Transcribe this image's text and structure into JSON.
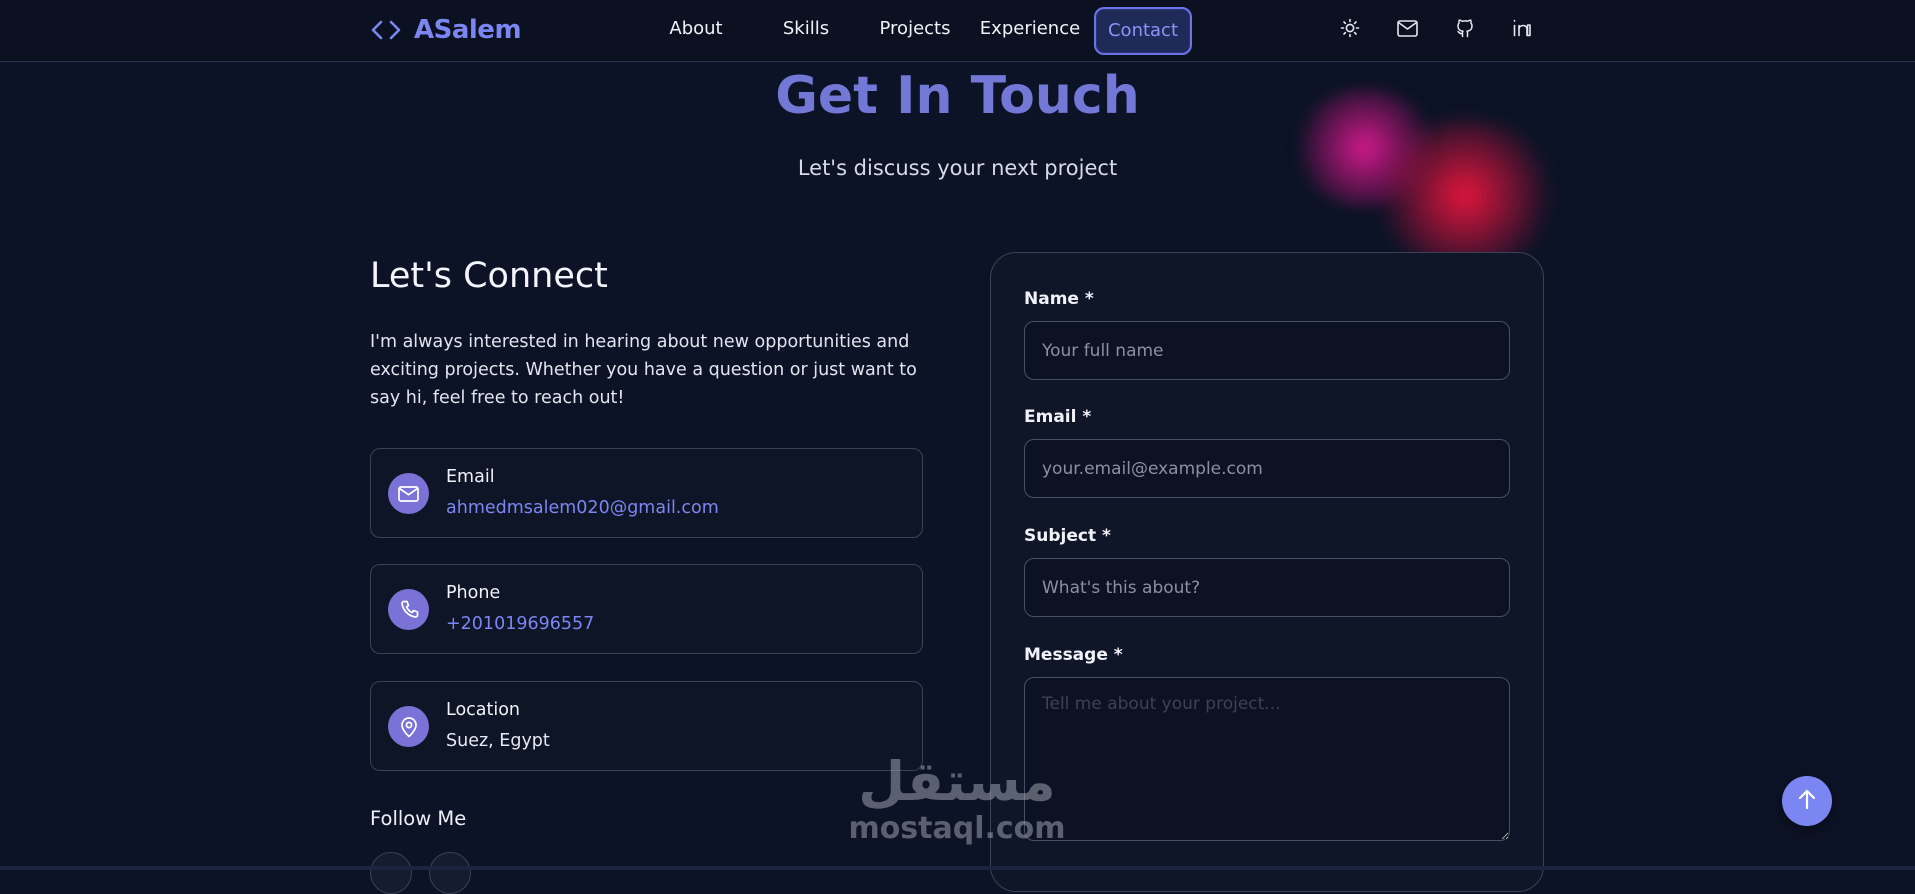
{
  "brand": {
    "name": "ASalem",
    "icon": "code-brackets-icon",
    "accent": "#7b86f2"
  },
  "nav": {
    "links": [
      {
        "label": "About"
      },
      {
        "label": "Skills"
      },
      {
        "label": "Projects"
      },
      {
        "label": "Experience"
      },
      {
        "label": "Contact",
        "active": true
      }
    ],
    "icons": [
      "sun-icon",
      "mail-icon",
      "github-icon",
      "linkedin-icon"
    ]
  },
  "hero": {
    "title": "Get In Touch",
    "subtitle": "Let's discuss your next project"
  },
  "connect": {
    "title": "Let's Connect",
    "text": "I'm always interested in hearing about new opportunities and exciting projects. Whether you have a question or just want to say hi, feel free to reach out!",
    "items": [
      {
        "icon": "mail-icon",
        "label": "Email",
        "value": "ahmedmsalem020@gmail.com"
      },
      {
        "icon": "phone-icon",
        "label": "Phone",
        "value": "+201019696557"
      },
      {
        "icon": "location-pin-icon",
        "label": "Location",
        "value": "Suez, Egypt"
      }
    ],
    "follow_title": "Follow Me"
  },
  "form": {
    "name": {
      "label": "Name *",
      "placeholder": "Your full name"
    },
    "email": {
      "label": "Email *",
      "placeholder": "your.email@example.com"
    },
    "subject": {
      "label": "Subject *",
      "placeholder": "What's this about?"
    },
    "message": {
      "label": "Message *",
      "placeholder": "Tell me about your project..."
    }
  },
  "watermark": {
    "arabic": "مستقل",
    "latin": "mostaql.com"
  },
  "scroll_top": {
    "icon": "arrow-up-icon"
  }
}
